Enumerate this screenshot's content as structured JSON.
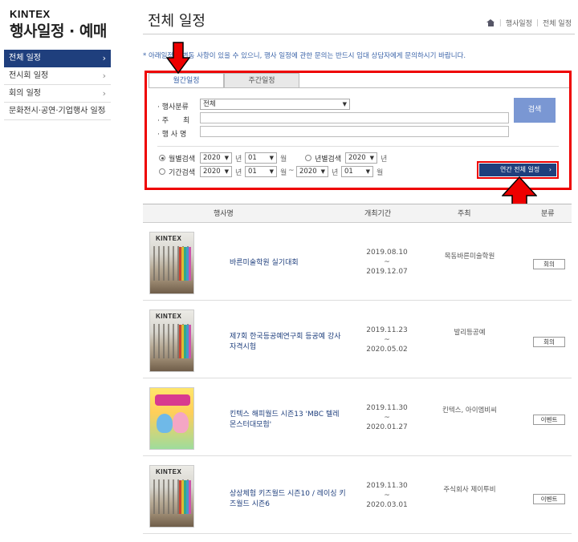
{
  "brand": {
    "logo": "KINTEX",
    "subtitle": "행사일정 · 예매"
  },
  "sidebar": {
    "items": [
      {
        "label": "전체 일정",
        "active": true
      },
      {
        "label": "전시회 일정",
        "active": false
      },
      {
        "label": "회의 일정",
        "active": false
      },
      {
        "label": "문화전시·공연·기업행사 일정",
        "active": false
      }
    ],
    "chevron": "›"
  },
  "header": {
    "title": "전체 일정",
    "breadcrumb": [
      "행사일정",
      "전체 일정"
    ],
    "separator": "|",
    "home_icon": "home-icon"
  },
  "notice": "* 아래일정은 변동 사항이 있을 수 있으니, 행사 일정에 관한 문의는 반드시 임대 상담자에게 문의하시기 바랍니다.",
  "tabs": [
    {
      "label": "월간일정",
      "active": true
    },
    {
      "label": "주간일정",
      "active": false
    }
  ],
  "search": {
    "category_label": "· 행사분류",
    "category_value": "전체",
    "host_label": "· 주　　최",
    "host_value": "",
    "name_label": "· 행 사 명",
    "name_value": "",
    "search_button": "검색",
    "monthly_label": "월별검색",
    "annual_label": "년별검색",
    "period_label": "기간검색",
    "year": "2020",
    "month": "01",
    "end_year": "2020",
    "end_month": "01",
    "unit_year": "년",
    "unit_month": "월",
    "range_sep": "~",
    "annual_button": "연간 전체 일정",
    "dropdown_arrow": "▼",
    "selected_mode": "monthly"
  },
  "table": {
    "headers": {
      "name": "행사명",
      "period": "개최기간",
      "host": "주최",
      "category": "분류"
    },
    "rows": [
      {
        "name": "바른미술학원 실기대회",
        "start": "2019.08.10",
        "tilde": "~",
        "end": "2019.12.07",
        "host": "목동바른미술학원",
        "category": "회의",
        "thumb": "hall"
      },
      {
        "name": "제7회 한국등공예연구회 등공예 강사 자격시험",
        "start": "2019.11.23",
        "tilde": "~",
        "end": "2020.05.02",
        "host": "발리등공예",
        "category": "회의",
        "thumb": "hall"
      },
      {
        "name": "킨텍스 해피월드 시즌13 'MBC 텔레 몬스터대모험'",
        "start": "2019.11.30",
        "tilde": "~",
        "end": "2020.01.27",
        "host": "킨텍스, 아이엠비씨",
        "category": "이벤트",
        "thumb": "poster"
      },
      {
        "name": "상상체험 키즈월드 시즌10 / 레이싱 키즈월드 시즌6",
        "start": "2019.11.30",
        "tilde": "~",
        "end": "2020.03.01",
        "host": "주식회사 제이투비",
        "category": "이벤트",
        "thumb": "hall"
      }
    ]
  },
  "colors": {
    "primary": "#1f3f7d",
    "search_button": "#7a97d3",
    "highlight": "#e00000",
    "notice": "#3a63a8"
  }
}
